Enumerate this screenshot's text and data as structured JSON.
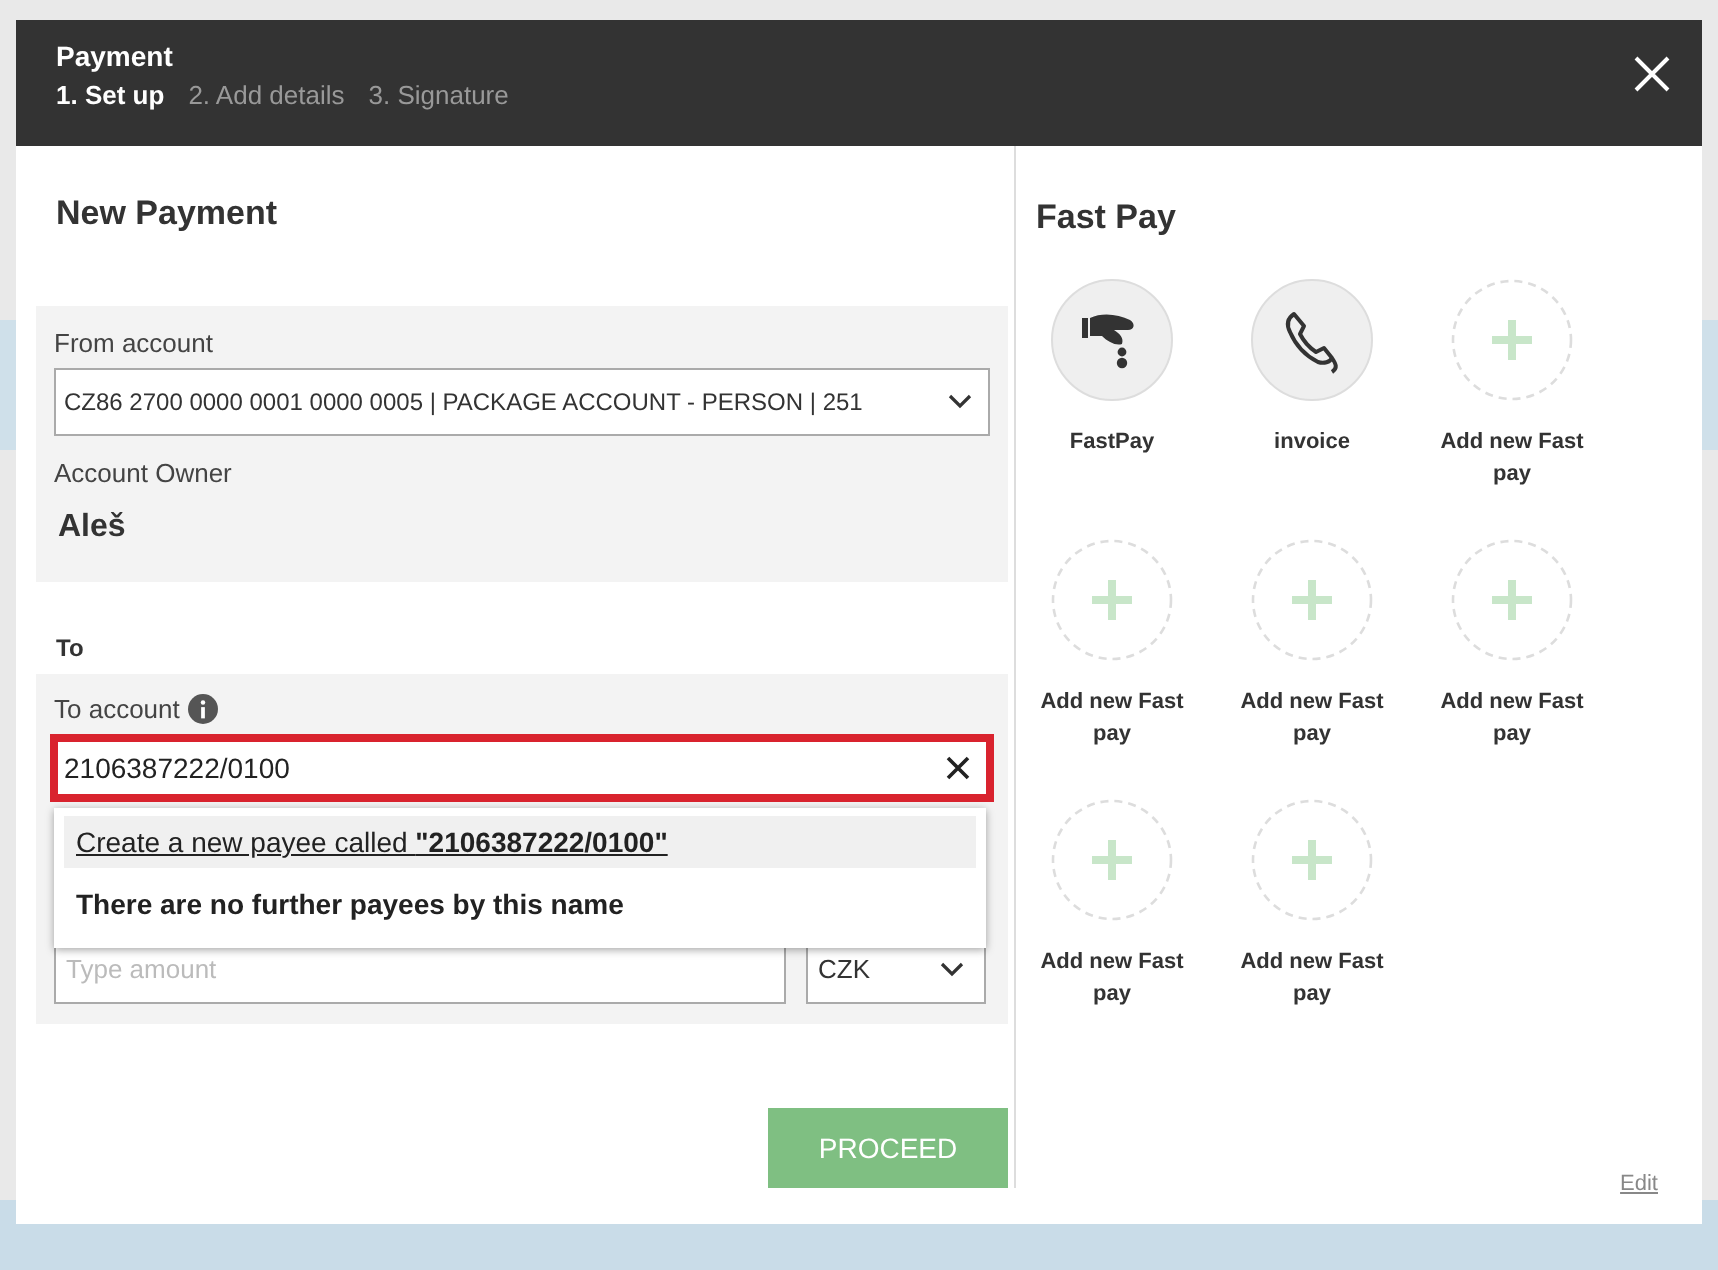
{
  "dialog": {
    "title": "Payment",
    "steps": [
      {
        "label": "1. Set up",
        "selected": true
      },
      {
        "label": "2. Add details",
        "selected": false
      },
      {
        "label": "3. Signature",
        "selected": false
      }
    ]
  },
  "new_payment": {
    "heading": "New Payment",
    "from_account": {
      "label": "From account",
      "value": "CZ86 2700 0000 0001 0000 0005 | PACKAGE ACCOUNT - PERSON | 251"
    },
    "account_owner": {
      "label": "Account Owner",
      "value": "Aleš"
    },
    "to_heading": "To",
    "to_account": {
      "label": "To account",
      "value": "2106387222/0100"
    },
    "suggestions": [
      {
        "kind": "create",
        "text": "Create a new payee called **\"2106387222/0100\"**",
        "highlighted": true
      },
      {
        "kind": "note",
        "text": "There are no further payees by this name",
        "highlighted": false
      }
    ],
    "amount": {
      "placeholder": "Type amount"
    },
    "currency": "CZK",
    "proceed": {
      "label": "PROCEED",
      "disabled": true
    }
  },
  "fast_pay": {
    "heading": "Fast Pay",
    "items": [
      {
        "kind": "fastpay",
        "label": "FastPay"
      },
      {
        "kind": "invoice",
        "label": "invoice"
      },
      {
        "kind": "add",
        "label": "Add new Fast pay"
      },
      {
        "kind": "add",
        "label": "Add new Fast pay"
      },
      {
        "kind": "add",
        "label": "Add new Fast pay"
      },
      {
        "kind": "add",
        "label": "Add new Fast pay"
      },
      {
        "kind": "add",
        "label": "Add new Fast pay"
      },
      {
        "kind": "add",
        "label": "Add new Fast pay"
      }
    ],
    "edit": "Edit"
  }
}
